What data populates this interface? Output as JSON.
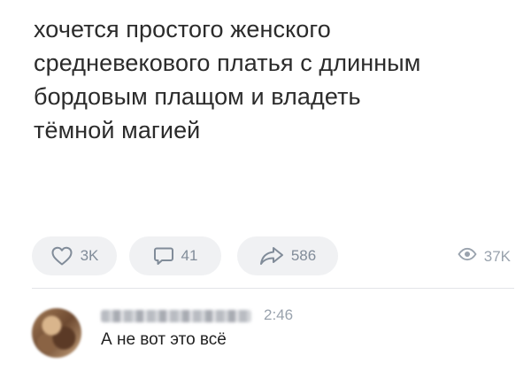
{
  "post": {
    "text_lines": [
      "хочется простого женского",
      "средневекового платья с длинным",
      "бордовым плащом и владеть",
      "тёмной магией"
    ]
  },
  "actions": {
    "likes": "3K",
    "comments": "41",
    "shares": "586",
    "views": "37K"
  },
  "icons": {
    "like": "heart-icon",
    "comment": "comment-bubble-icon",
    "share": "share-arrow-icon",
    "views": "eye-icon"
  },
  "comment": {
    "time": "2:46",
    "text": "А не вот это всё"
  },
  "colors": {
    "pill_background": "#f0f1f3",
    "icon_gray": "#818c99",
    "text": "#222222"
  }
}
